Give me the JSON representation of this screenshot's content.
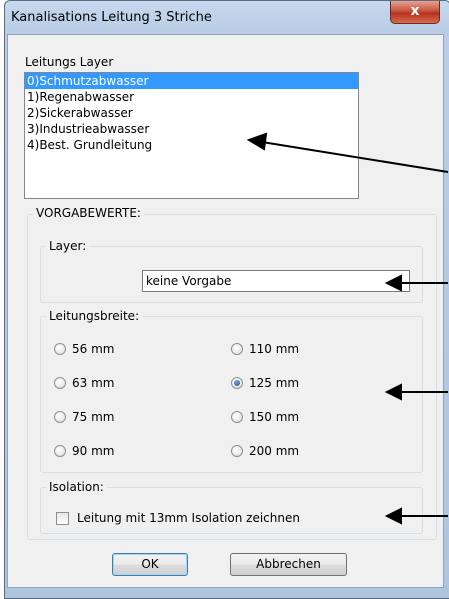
{
  "window": {
    "title": "Kanalisations Leitung 3 Striche",
    "close_glyph": "x"
  },
  "layer_list": {
    "label": "Leitungs Layer",
    "items": [
      "0)Schmutzabwasser",
      "1)Regenabwasser",
      "2)Sickerabwasser",
      "3)Industrieabwasser",
      "4)Best. Grundleitung"
    ],
    "selected_index": 0
  },
  "defaults": {
    "group_label": "VORGABEWERTE:",
    "layer": {
      "label": "Layer:",
      "value": "keine Vorgabe"
    },
    "width": {
      "label": "Leitungsbreite:",
      "options": [
        "56 mm",
        "63 mm",
        "75 mm",
        "90 mm",
        "110 mm",
        "125 mm",
        "150 mm",
        "200 mm"
      ],
      "selected": "125 mm"
    },
    "isolation": {
      "label": "Isolation:",
      "checkbox_label": "Leitung mit 13mm Isolation zeichnen",
      "checked": false
    }
  },
  "buttons": {
    "ok": "OK",
    "cancel": "Abbrechen"
  },
  "colors": {
    "selection": "#3399ff",
    "close": "#c8543f",
    "frame": "#b9cde6"
  }
}
